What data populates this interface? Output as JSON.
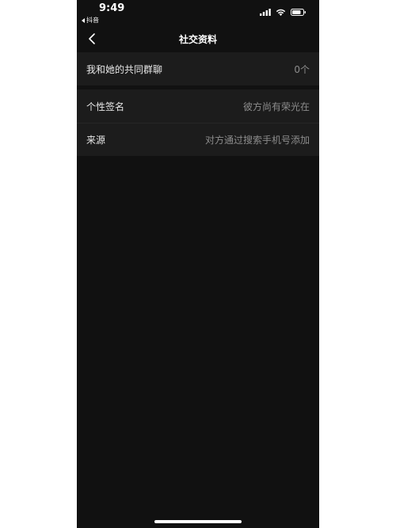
{
  "status_bar": {
    "time": "9:49",
    "back_app": "抖音"
  },
  "nav": {
    "title": "社交资料"
  },
  "sections": [
    {
      "rows": [
        {
          "label": "我和她的共同群聊",
          "value": "0个"
        }
      ]
    },
    {
      "rows": [
        {
          "label": "个性签名",
          "value": "彼方尚有荣光在"
        },
        {
          "label": "来源",
          "value": "对方通过搜索手机号添加"
        }
      ]
    }
  ],
  "icons": {
    "back": "chevron-left-icon",
    "signal": "cellular-signal-icon",
    "wifi": "wifi-icon",
    "battery": "battery-icon"
  },
  "colors": {
    "background": "#111111",
    "section_background": "#1c1c1c",
    "label_text": "#e8e8e8",
    "value_text": "#8c8c8c"
  }
}
